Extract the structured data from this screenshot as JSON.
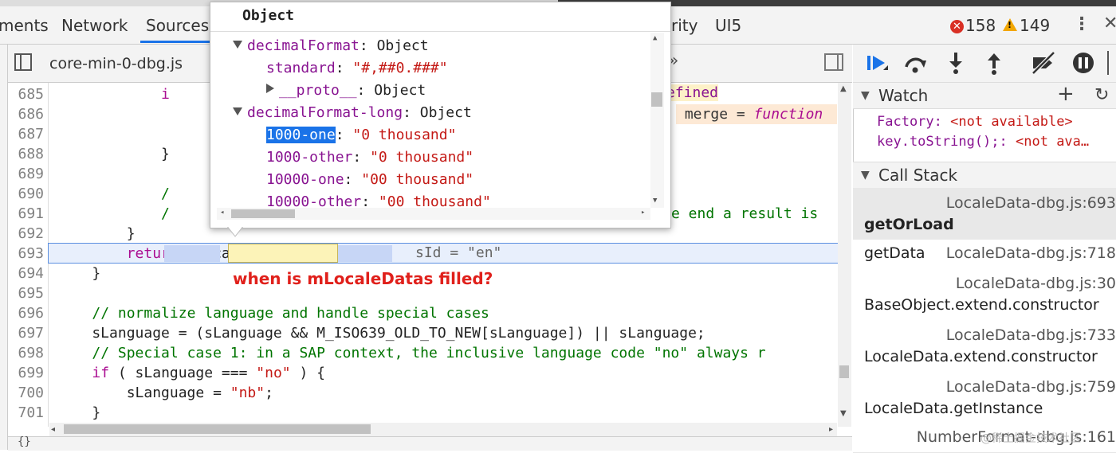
{
  "tabs": [
    "ments",
    "Network",
    "Sources",
    "rity",
    "UI5"
  ],
  "status": {
    "errors": "158",
    "warnings": "149"
  },
  "file_tab": "core-min-0-dbg.js",
  "popover": {
    "title": "Object",
    "lines": [
      {
        "indent": 0,
        "toggle": "down",
        "key": "decimalFormat",
        "sep": ": ",
        "val": "Object",
        "valtype": "plain"
      },
      {
        "indent": 1,
        "toggle": "",
        "key": "standard",
        "sep": ": ",
        "val": "\"#,##0.###\"",
        "valtype": "str"
      },
      {
        "indent": 1,
        "toggle": "right",
        "key": "__proto__",
        "sep": ": ",
        "val": "Object",
        "valtype": "plain"
      },
      {
        "indent": 0,
        "toggle": "down",
        "key": "decimalFormat-long",
        "sep": ": ",
        "val": "Object",
        "valtype": "plain"
      },
      {
        "indent": 1,
        "toggle": "",
        "key": "1000-one",
        "sep": ": ",
        "val": "\"0 thousand\"",
        "valtype": "str",
        "selected": true
      },
      {
        "indent": 1,
        "toggle": "",
        "key": "1000-other",
        "sep": ": ",
        "val": "\"0 thousand\"",
        "valtype": "str"
      },
      {
        "indent": 1,
        "toggle": "",
        "key": "10000-one",
        "sep": ": ",
        "val": "\"00 thousand\"",
        "valtype": "str"
      },
      {
        "indent": 1,
        "toggle": "",
        "key": "10000-other",
        "sep": ": ",
        "val": "\"00 thousand\"",
        "valtype": "str"
      }
    ]
  },
  "code_lines": [
    {
      "n": "685",
      "html": "            <span class=\"kw\">i</span>"
    },
    {
      "n": "686",
      "html": ""
    },
    {
      "n": "687",
      "html": ""
    },
    {
      "n": "688",
      "html": "            }"
    },
    {
      "n": "689",
      "html": ""
    },
    {
      "n": "690",
      "html": "            <span class=\"cm\">/</span>"
    },
    {
      "n": "691",
      "html": "            <span class=\"cm\">/</span>"
    },
    {
      "n": "692",
      "html": "        }"
    },
    {
      "n": "693",
      "html": "        <span class=\"kw\">return</span> mLocaleDatas[sId];"
    },
    {
      "n": "694",
      "html": "    }"
    },
    {
      "n": "695",
      "html": ""
    },
    {
      "n": "696",
      "html": "    <span class=\"cm\">// normalize language and handle special cases</span>"
    },
    {
      "n": "697",
      "html": "    sLanguage = (sLanguage && M_ISO639_OLD_TO_NEW[sLanguage]) || sLanguage;"
    },
    {
      "n": "698",
      "html": "    <span class=\"cm\">// Special case 1: in a SAP context, the inclusive language code \"no\" always r</span>"
    },
    {
      "n": "699",
      "html": "    <span class=\"kw\">if</span> ( sLanguage === <span class=\"st\">\"no\"</span> ) {"
    },
    {
      "n": "700",
      "html": "        sLanguage = <span class=\"st\">\"nb\"</span>;"
    },
    {
      "n": "701",
      "html": "    }"
    },
    {
      "n": "702",
      "html": ""
    }
  ],
  "code_fragments": {
    "efined": "efined",
    "merge": "merge = ",
    "function": "function",
    "result": "e end a result is",
    "inline_hint": "sId = \"en\""
  },
  "annotation": "when is mLocaleDatas filled?",
  "watch": {
    "header": "Watch",
    "items": [
      {
        "expr": "Factory",
        "val": "<not available>"
      },
      {
        "expr": "key.toString();",
        "val": "<not ava…"
      }
    ]
  },
  "callstack": {
    "header": "Call Stack",
    "frames": [
      {
        "name": "getOrLoad",
        "loc": "LocaleData-dbg.js:693",
        "active": true,
        "layout": "two-line"
      },
      {
        "name": "getData",
        "loc": "LocaleData-dbg.js:718",
        "active": false,
        "layout": "one-line"
      },
      {
        "name": "BaseObject.extend.constructor",
        "loc": "LocaleData-dbg.js:30",
        "active": false,
        "layout": "two-line"
      },
      {
        "name": "LocaleData.extend.constructor",
        "loc": "LocaleData-dbg.js:733",
        "active": false,
        "layout": "two-line"
      },
      {
        "name": "LocaleData.getInstance",
        "loc": "LocaleData-dbg.js:759",
        "active": false,
        "layout": "two-line"
      },
      {
        "name": "",
        "loc": "NumberFormat-dbg.js:161",
        "active": false,
        "layout": "one-line"
      }
    ]
  },
  "watermark": "@稀土掘金技术社区"
}
